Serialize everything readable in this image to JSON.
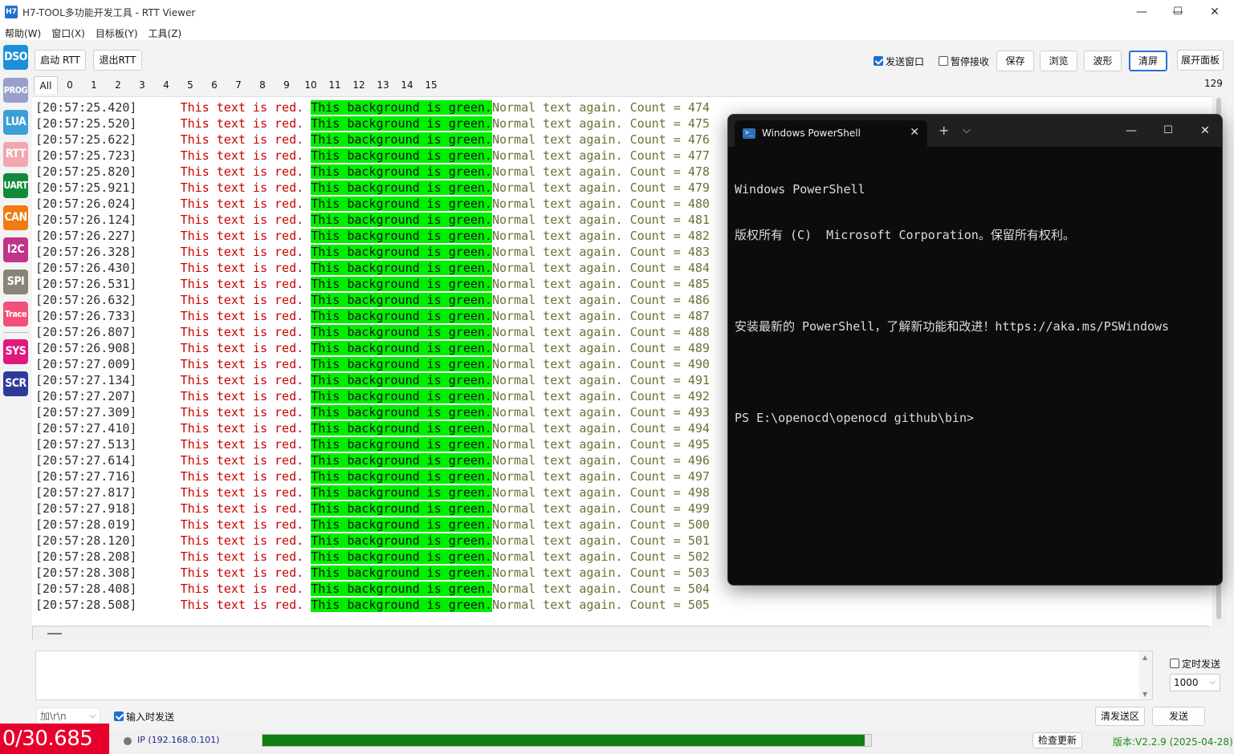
{
  "window": {
    "app_icon": "H7",
    "title": "H7-TOOL多功能开发工具 - RTT Viewer",
    "controls": [
      "—",
      "☐",
      "✕"
    ]
  },
  "menu": [
    "帮助(W)",
    "窗口(X)",
    "目标板(Y)",
    "工具(Z)"
  ],
  "sidebar_tools": [
    {
      "label": "DSO",
      "color": "#1d8fd8"
    },
    {
      "label": "PROG",
      "color": "#9a9fc9"
    },
    {
      "label": "LUA",
      "color": "#3a9fd8"
    },
    {
      "label": "RTT",
      "color": "#f2a6b0"
    },
    {
      "label": "UART",
      "color": "#138a3a"
    },
    {
      "label": "CAN",
      "color": "#f07b12"
    },
    {
      "label": "I2C",
      "color": "#c2338a"
    },
    {
      "label": "SPI",
      "color": "#8a8378"
    },
    {
      "label": "Trace",
      "color": "#f0507a"
    },
    {
      "label": "SYS",
      "color": "#e0197d"
    },
    {
      "label": "SCR",
      "color": "#2e3a9a"
    }
  ],
  "toolbar": {
    "start_rtt": "启动 RTT",
    "exit_rtt": "退出RTT",
    "send_window": "发送窗口",
    "pause_receive": "暂停接收",
    "save": "保存",
    "browse": "浏览",
    "waveform": "波形",
    "clear": "清屏",
    "expand_panel": "展开面板"
  },
  "checkbox_states": {
    "send_window": true,
    "pause_receive": false
  },
  "channel_tabs": [
    "All",
    "0",
    "1",
    "2",
    "3",
    "4",
    "5",
    "6",
    "7",
    "8",
    "9",
    "10",
    "11",
    "12",
    "13",
    "14",
    "15"
  ],
  "active_tab": "All",
  "line_count": "129",
  "rtt_log": [
    {
      "ts": "[20:57:25.420]",
      "count": "474"
    },
    {
      "ts": "[20:57:25.520]",
      "count": "475"
    },
    {
      "ts": "[20:57:25.622]",
      "count": "476"
    },
    {
      "ts": "[20:57:25.723]",
      "count": "477"
    },
    {
      "ts": "[20:57:25.820]",
      "count": "478"
    },
    {
      "ts": "[20:57:25.921]",
      "count": "479"
    },
    {
      "ts": "[20:57:26.024]",
      "count": "480"
    },
    {
      "ts": "[20:57:26.124]",
      "count": "481"
    },
    {
      "ts": "[20:57:26.227]",
      "count": "482"
    },
    {
      "ts": "[20:57:26.328]",
      "count": "483"
    },
    {
      "ts": "[20:57:26.430]",
      "count": "484"
    },
    {
      "ts": "[20:57:26.531]",
      "count": "485"
    },
    {
      "ts": "[20:57:26.632]",
      "count": "486"
    },
    {
      "ts": "[20:57:26.733]",
      "count": "487"
    },
    {
      "ts": "[20:57:26.807]",
      "count": "488"
    },
    {
      "ts": "[20:57:26.908]",
      "count": "489"
    },
    {
      "ts": "[20:57:27.009]",
      "count": "490"
    },
    {
      "ts": "[20:57:27.134]",
      "count": "491"
    },
    {
      "ts": "[20:57:27.207]",
      "count": "492"
    },
    {
      "ts": "[20:57:27.309]",
      "count": "493"
    },
    {
      "ts": "[20:57:27.410]",
      "count": "494"
    },
    {
      "ts": "[20:57:27.513]",
      "count": "495"
    },
    {
      "ts": "[20:57:27.614]",
      "count": "496"
    },
    {
      "ts": "[20:57:27.716]",
      "count": "497"
    },
    {
      "ts": "[20:57:27.817]",
      "count": "498"
    },
    {
      "ts": "[20:57:27.918]",
      "count": "499"
    },
    {
      "ts": "[20:57:28.019]",
      "count": "500"
    },
    {
      "ts": "[20:57:28.120]",
      "count": "501"
    },
    {
      "ts": "[20:57:28.208]",
      "count": "502"
    },
    {
      "ts": "[20:57:28.308]",
      "count": "503"
    },
    {
      "ts": "[20:57:28.408]",
      "count": "504"
    },
    {
      "ts": "[20:57:28.508]",
      "count": "505"
    }
  ],
  "rtt_segments": {
    "red": "This text is red.",
    "green": "This background is green.",
    "normal": "Normal text again.",
    "count_prefix": "Count = "
  },
  "rtt_colors": {
    "red": "#cc0000",
    "green_bg": "#00ee00"
  },
  "powershell": {
    "tab_title": "Windows PowerShell",
    "tab_close": "✕",
    "new_tab": "+",
    "dropdown": "⌵",
    "lines": [
      "Windows PowerShell",
      "版权所有 (C)  Microsoft Corporation。保留所有权利。",
      "",
      "安装最新的 PowerShell，了解新功能和改进！https://aka.ms/PSWindows",
      "",
      "PS E:\\openocd\\openocd github\\bin>"
    ]
  },
  "send": {
    "input_value": "",
    "timed_send": "定时发送",
    "timed_send_checked": false,
    "interval": "1000",
    "suffix": "加\\r\\n",
    "send_on_input": "输入时发送",
    "send_on_input_checked": true,
    "clear_send": "清发送区",
    "send_button": "发送"
  },
  "status": {
    "timer": "0/30.685 s",
    "ip": "IP (192.168.0.101)",
    "progress": 0.99,
    "check_update": "检查更新",
    "version": "版本:V2.2.9 (2025-04-28)",
    "accent": "#e8002c"
  }
}
